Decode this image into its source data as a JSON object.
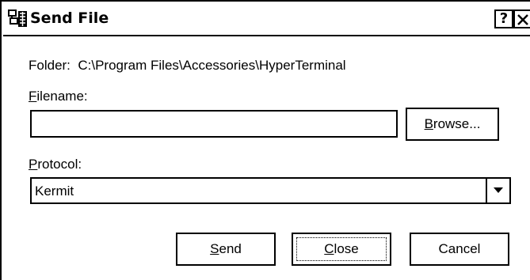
{
  "window": {
    "title": "Send File",
    "icon": "hyperterminal-icon",
    "help_label": "?",
    "close_label": "✕"
  },
  "folder": {
    "label": "Folder:",
    "path": "C:\\Program Files\\Accessories\\HyperTerminal"
  },
  "filename": {
    "label_mnemonic": "F",
    "label_rest": "ilename:",
    "value": "",
    "browse_mnemonic": "B",
    "browse_rest": "rowse..."
  },
  "protocol": {
    "label_mnemonic": "P",
    "label_rest": "rotocol:",
    "selected": "Kermit",
    "dropdown_icon": "chevron-down-icon"
  },
  "buttons": {
    "send_mnemonic": "S",
    "send_rest": "end",
    "close_mnemonic": "C",
    "close_rest": "lose",
    "cancel_label": "Cancel"
  }
}
